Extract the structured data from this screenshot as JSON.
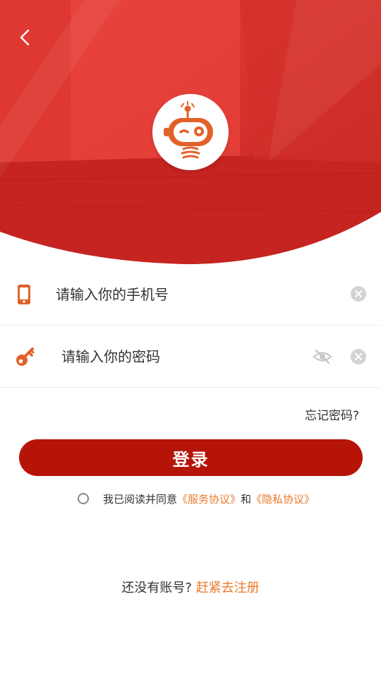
{
  "header": {
    "back_icon": "chevron-left-icon",
    "logo_icon": "robot-mascot-icon",
    "bg_color": "#d8302c"
  },
  "phone_field": {
    "icon": "phone-icon",
    "placeholder": "请输入你的手机号",
    "value": "",
    "clear_icon": "clear-icon"
  },
  "password_field": {
    "icon": "key-icon",
    "placeholder": "请输入你的密码",
    "value": "",
    "visibility_icon": "eye-off-icon",
    "clear_icon": "clear-icon"
  },
  "forgot_password": "忘记密码?",
  "login_button": "登录",
  "agreement": {
    "checked": false,
    "prefix": "我已阅读并同意",
    "service_link": "《服务协议》",
    "and": "和",
    "privacy_link": "《隐私协议》"
  },
  "register": {
    "prompt": "还没有账号?",
    "link": "赶紧去注册"
  },
  "colors": {
    "accent": "#b71409",
    "link": "#ea7a2c",
    "icon": "#e2612a"
  }
}
